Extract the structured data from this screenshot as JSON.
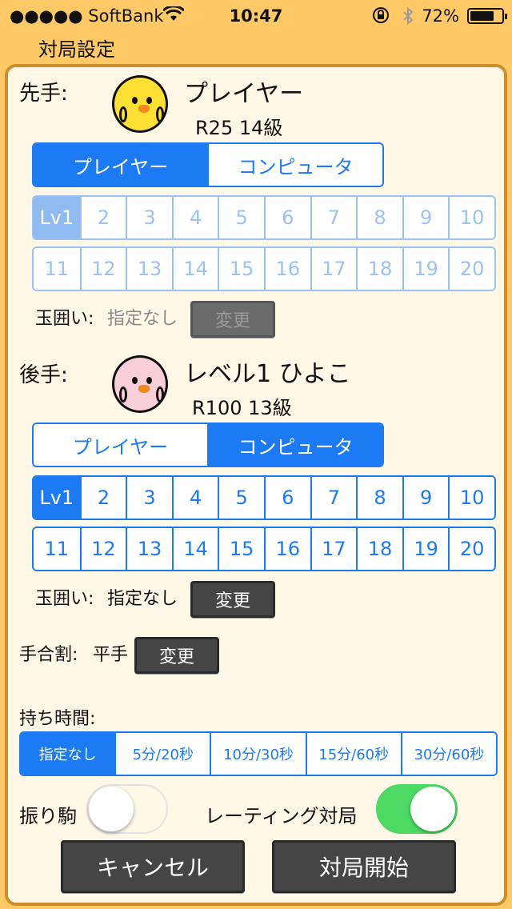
{
  "status": {
    "carrier": "●●●●● SoftBank ",
    "time": "10:47",
    "battery": "72%",
    "battery_level": 0.72,
    "icons": [
      "wifi-icon",
      "rotation-lock-icon",
      "bluetooth-icon",
      "battery-icon"
    ]
  },
  "nav": {
    "title": "対局設定"
  },
  "sente": {
    "label": "先手:",
    "name": "プレイヤー",
    "rating": "R25 14級",
    "avatar_color": "#ffe033",
    "type_options": [
      "プレイヤー",
      "コンピュータ"
    ],
    "type_selected": "プレイヤー",
    "levels_row1": [
      "Lv1",
      "2",
      "3",
      "4",
      "5",
      "6",
      "7",
      "8",
      "9",
      "10"
    ],
    "levels_row2": [
      "11",
      "12",
      "13",
      "14",
      "15",
      "16",
      "17",
      "18",
      "19",
      "20"
    ],
    "level_selected": "Lv1",
    "levels_enabled": false,
    "castle_label": "玉囲い:",
    "castle_value": "指定なし",
    "castle_button": "変更"
  },
  "gote": {
    "label": "後手:",
    "name": "レベル1 ひよこ",
    "rating": "R100 13級",
    "avatar_color": "#f9cfd9",
    "type_options": [
      "プレイヤー",
      "コンピュータ"
    ],
    "type_selected": "コンピュータ",
    "levels_row1": [
      "Lv1",
      "2",
      "3",
      "4",
      "5",
      "6",
      "7",
      "8",
      "9",
      "10"
    ],
    "levels_row2": [
      "11",
      "12",
      "13",
      "14",
      "15",
      "16",
      "17",
      "18",
      "19",
      "20"
    ],
    "level_selected": "Lv1",
    "levels_enabled": true,
    "castle_label": "玉囲い:",
    "castle_value": "指定なし",
    "castle_button": "変更"
  },
  "handicap": {
    "label": "手合割:",
    "value": "平手",
    "button": "変更"
  },
  "time": {
    "label": "持ち時間:",
    "options": [
      "指定なし",
      "5分/20秒",
      "10分/30秒",
      "15分/60秒",
      "30分/60秒"
    ],
    "selected": "指定なし"
  },
  "furigoma": {
    "label": "振り駒",
    "on": false
  },
  "rating_match": {
    "label": "レーティング対局",
    "on": true
  },
  "actions": {
    "cancel": "キャンセル",
    "start": "対局開始"
  },
  "colors": {
    "accent": "#1b7af4",
    "switch_on": "#4cd964",
    "panel_border": "#cf8e2c",
    "background": "#ffc966"
  }
}
